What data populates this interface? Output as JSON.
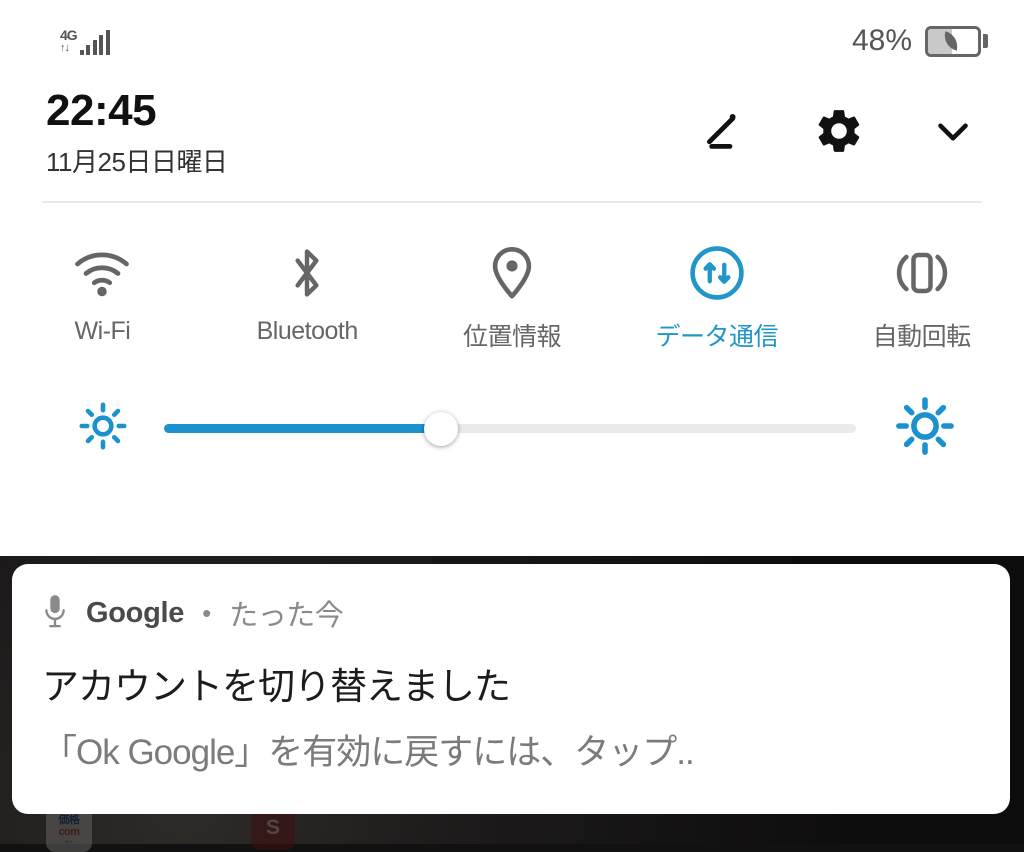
{
  "status_bar": {
    "network_type": "4G",
    "network_arrows": "↑↓",
    "signal_bars": 5,
    "battery_percent": "48%",
    "battery_level": 48,
    "battery_saver_icon": "leaf-icon"
  },
  "header": {
    "time": "22:45",
    "date": "11月25日日曜日",
    "actions": [
      {
        "name": "edit-icon",
        "label": "編集"
      },
      {
        "name": "gear-icon",
        "label": "設定"
      },
      {
        "name": "chevron-down-icon",
        "label": "展開"
      }
    ]
  },
  "quick_settings": {
    "tiles": [
      {
        "label": "Wi-Fi",
        "icon": "wifi-icon",
        "active": false
      },
      {
        "label": "Bluetooth",
        "icon": "bluetooth-icon",
        "active": false
      },
      {
        "label": "位置情報",
        "icon": "location-pin-icon",
        "active": false
      },
      {
        "label": "データ通信",
        "icon": "mobile-data-icon",
        "active": true
      },
      {
        "label": "自動回転",
        "icon": "auto-rotate-icon",
        "active": false
      }
    ]
  },
  "brightness": {
    "value_percent": 40,
    "low_icon": "brightness-low-icon",
    "high_icon": "brightness-high-icon"
  },
  "notification": {
    "icon": "microphone-icon",
    "app_name": "Google",
    "separator": "•",
    "time": "たった今",
    "title": "アカウントを切り替えました",
    "body": "「Ok Google」を有効に戻すには、タップ.."
  },
  "home_screen": {
    "app_icons": [
      {
        "name": "kakaku-com-app-icon",
        "line1": "価格",
        "line2": "com",
        "line3": "キャ"
      },
      {
        "name": "s-app-icon",
        "letter": "S"
      }
    ]
  },
  "colors": {
    "accent_blue": "#1b91cd",
    "tile_active": "#2196c9",
    "tile_inactive": "#666666",
    "panel_bg": "#ffffff"
  }
}
